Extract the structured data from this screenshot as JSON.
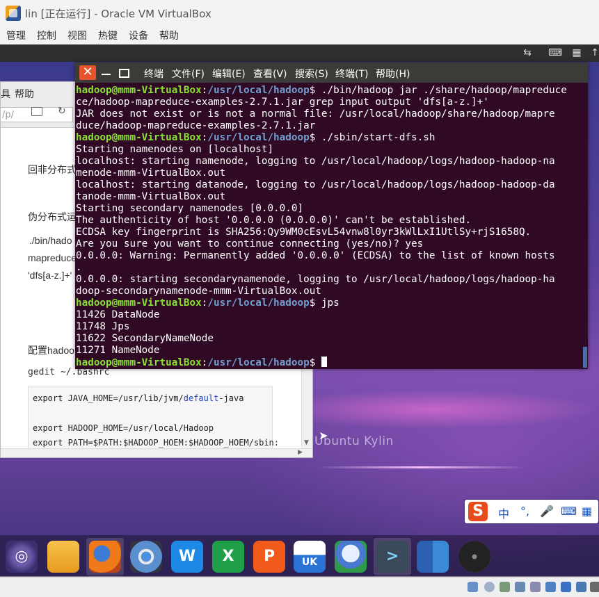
{
  "window": {
    "title": "lin [正在运行] - Oracle VM VirtualBox",
    "menu": [
      "管理",
      "控制",
      "视图",
      "热键",
      "设备",
      "帮助"
    ]
  },
  "browser": {
    "menu_partial": "具",
    "menu_help": "帮助",
    "url_fragment": "/p/",
    "article": {
      "line1": "回非分布式",
      "line2": "伪分布式运",
      "cmd1": "./bin/hado",
      "cmd2": "mapreduce",
      "cmd3": "'dfs[a-z.]+'",
      "line3": "配置hadoo",
      "line4": "gedit ~/.bashrc"
    },
    "code": {
      "line1_prefix": "export JAVA_HOME=/usr/lib/jvm/",
      "line1_keyword": "default",
      "line1_suffix": "-java",
      "line2": "export HADOOP_HOME=/usr/local/Hadoop",
      "line3": "export PATH=$PATH:$HADOOP_HOEM:$HADOOP_HOEM/sbin:"
    }
  },
  "terminal": {
    "title": "终端",
    "menu": [
      "文件(F)",
      "编辑(E)",
      "查看(V)",
      "搜索(S)",
      "终端(T)",
      "帮助(H)"
    ],
    "prompt_user": "hadoop@mmm-VirtualBox",
    "prompt_sep": ":",
    "prompt_path": "/usr/local/hadoop",
    "prompt_end": "$ ",
    "lines": [
      {
        "type": "cmd",
        "text": "./bin/hadoop jar ./share/hadoop/mapreduce"
      },
      {
        "type": "out",
        "text": "ce/hadoop-mapreduce-examples-2.7.1.jar grep input output 'dfs[a-z.]+'"
      },
      {
        "type": "out",
        "text": "JAR does not exist or is not a normal file: /usr/local/hadoop/share/hadoop/mapre"
      },
      {
        "type": "out",
        "text": "duce/hadoop-mapreduce-examples-2.7.1.jar"
      },
      {
        "type": "cmd",
        "text": "./sbin/start-dfs.sh"
      },
      {
        "type": "out",
        "text": "Starting namenodes on [localhost]"
      },
      {
        "type": "out",
        "text": "localhost: starting namenode, logging to /usr/local/hadoop/logs/hadoop-hadoop-na"
      },
      {
        "type": "out",
        "text": "menode-mmm-VirtualBox.out"
      },
      {
        "type": "out",
        "text": "localhost: starting datanode, logging to /usr/local/hadoop/logs/hadoop-hadoop-da"
      },
      {
        "type": "out",
        "text": "tanode-mmm-VirtualBox.out"
      },
      {
        "type": "out",
        "text": "Starting secondary namenodes [0.0.0.0]"
      },
      {
        "type": "out",
        "text": "The authenticity of host '0.0.0.0 (0.0.0.0)' can't be established."
      },
      {
        "type": "out",
        "text": "ECDSA key fingerprint is SHA256:Qy9WM0cEsvL54vnw8l0yr3kWlLxI1UtlSy+rjS1658Q."
      },
      {
        "type": "out",
        "text": "Are you sure you want to continue connecting (yes/no)? yes"
      },
      {
        "type": "out",
        "text": "0.0.0.0: Warning: Permanently added '0.0.0.0' (ECDSA) to the list of known hosts"
      },
      {
        "type": "out",
        "text": "."
      },
      {
        "type": "out",
        "text": "0.0.0.0: starting secondarynamenode, logging to /usr/local/hadoop/logs/hadoop-ha"
      },
      {
        "type": "out",
        "text": "doop-secondarynamenode-mmm-VirtualBox.out"
      },
      {
        "type": "cmd",
        "text": "jps"
      },
      {
        "type": "out",
        "text": "11426 DataNode"
      },
      {
        "type": "out",
        "text": "11748 Jps"
      },
      {
        "type": "out",
        "text": "11622 SecondaryNameNode"
      },
      {
        "type": "out",
        "text": "11271 NameNode"
      },
      {
        "type": "cmd",
        "text": ""
      }
    ]
  },
  "desktop": {
    "brand": "Ubuntu Kylin"
  },
  "ime": {
    "logo": "S",
    "lang": "中",
    "punct": "°,",
    "mic": "🎤",
    "keyboard": "⌨",
    "grid": "▦"
  },
  "dock": {
    "icons": [
      "ubuntu-kylin-icon",
      "files-icon",
      "firefox-icon",
      "chromium-icon",
      "wps-writer-icon",
      "wps-spreadsheet-icon",
      "wps-presentation-icon",
      "kylin-software-center-icon",
      "youker-assistant-icon",
      "terminal-icon",
      "workspace-switcher-icon",
      "dvd-icon"
    ],
    "labels": {
      "wps_w": "W",
      "wps_s": "X",
      "wps_p": "P",
      "uk": "UK",
      "terminal": ">"
    }
  },
  "colors": {
    "terminal_bg": "#300a24",
    "prompt_user": "#8ae234",
    "prompt_path": "#729fcf",
    "close_button": "#e8532b"
  }
}
